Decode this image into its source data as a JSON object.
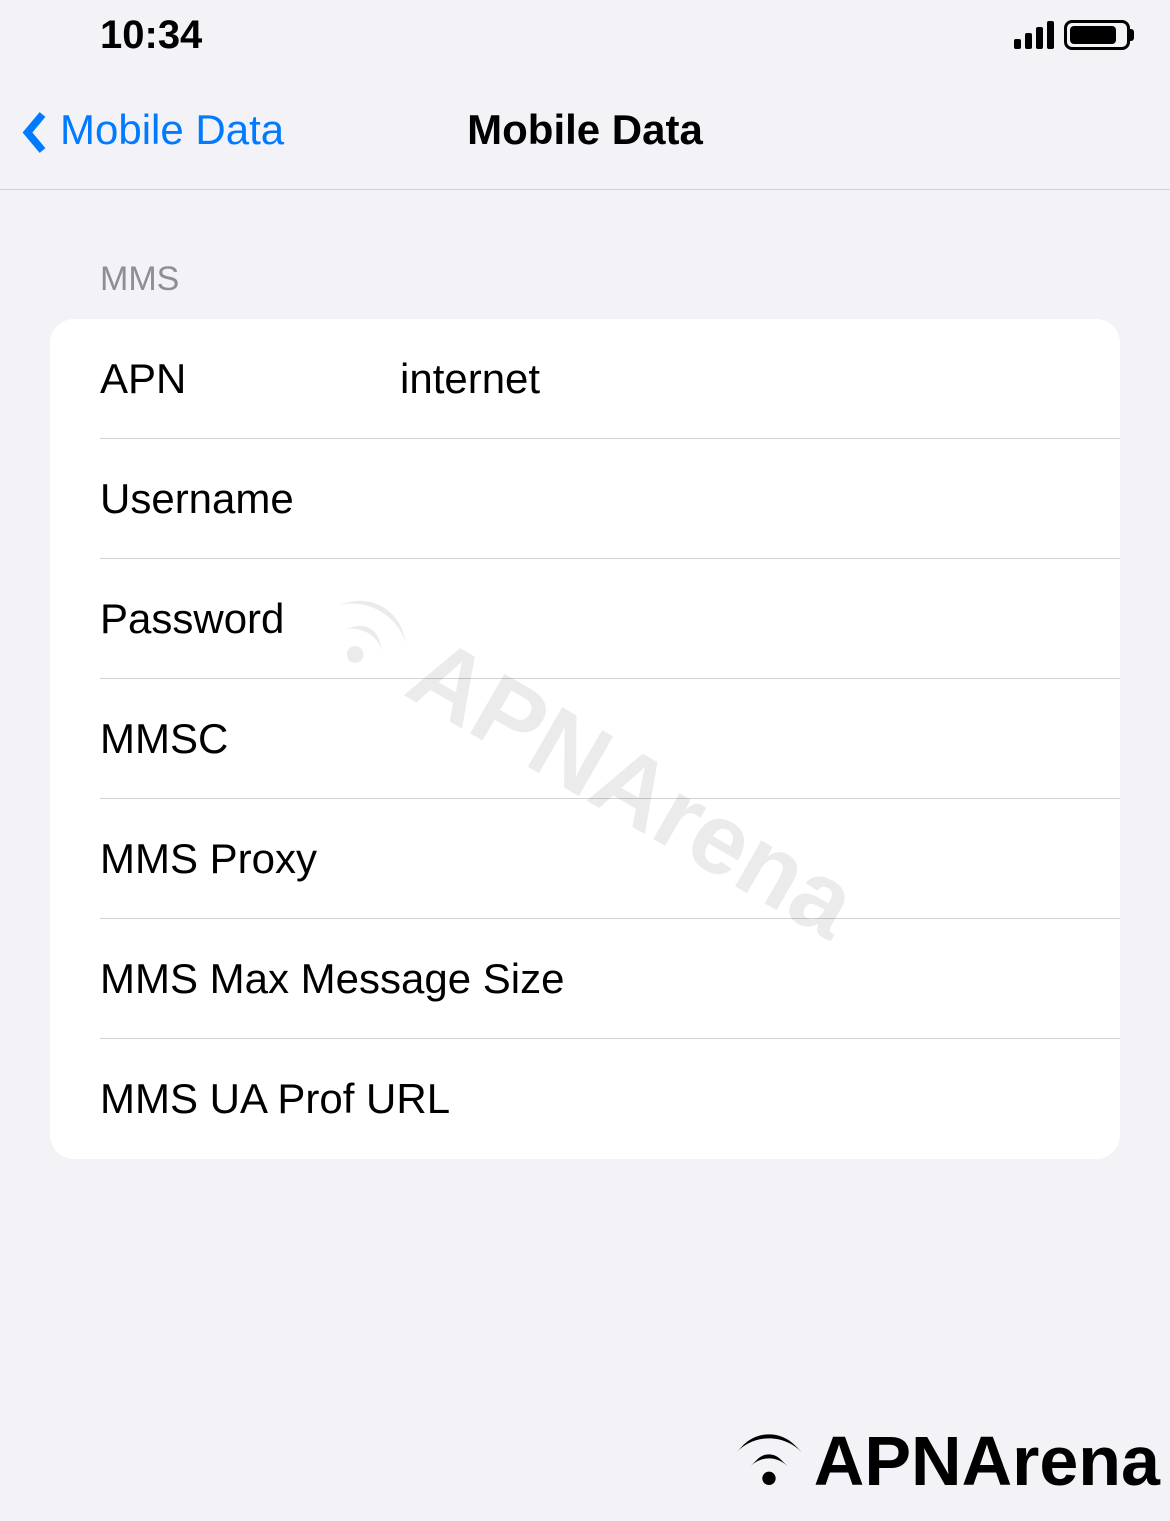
{
  "statusBar": {
    "time": "10:34"
  },
  "navBar": {
    "backLabel": "Mobile Data",
    "title": "Mobile Data"
  },
  "section": {
    "header": "MMS",
    "rows": [
      {
        "label": "APN",
        "value": "internet"
      },
      {
        "label": "Username",
        "value": ""
      },
      {
        "label": "Password",
        "value": ""
      },
      {
        "label": "MMSC",
        "value": ""
      },
      {
        "label": "MMS Proxy",
        "value": ""
      },
      {
        "label": "MMS Max Message Size",
        "value": ""
      },
      {
        "label": "MMS UA Prof URL",
        "value": ""
      }
    ]
  },
  "watermark": {
    "text": "APNArena"
  }
}
